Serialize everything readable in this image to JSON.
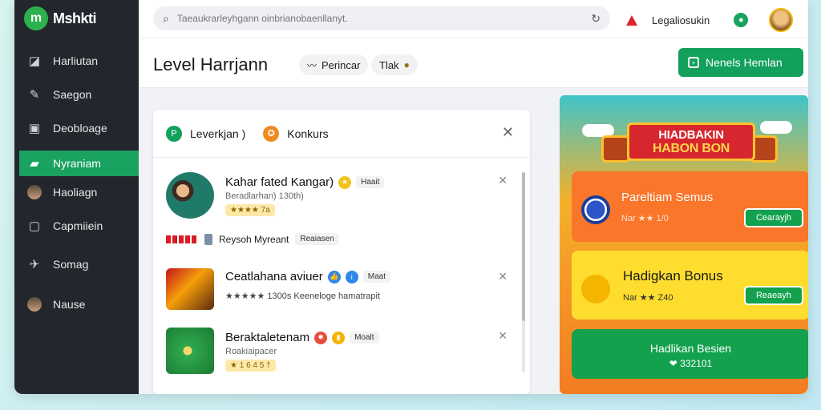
{
  "app": {
    "name": "Mshkti"
  },
  "sidebar": {
    "items": [
      {
        "label": "Harliutan",
        "icon": "dashboard-icon",
        "active": false
      },
      {
        "label": "Saegon",
        "icon": "pen-icon",
        "active": false
      },
      {
        "label": "Deobloage",
        "icon": "door-icon",
        "active": false
      },
      {
        "label": "Nyraniam",
        "icon": "folder-icon",
        "active": true
      },
      {
        "label": "Haoliagn",
        "icon": "user-avatar-icon",
        "active": false
      },
      {
        "label": "Capmiiein",
        "icon": "square-icon",
        "active": false
      },
      {
        "label": "Somag",
        "icon": "bird-icon",
        "active": false
      },
      {
        "label": "Nause",
        "icon": "user-avatar-icon",
        "active": false
      }
    ]
  },
  "topbar": {
    "search_placeholder": "Taeaukrarleyhgann oinbrianobaenllanyt.",
    "link": "Legaliosukin"
  },
  "header": {
    "title": "Level Harrjann",
    "chip1": "Perincar",
    "chip2": "Tlak",
    "cta": "Nenels Hemlan"
  },
  "panel": {
    "tab1": "Leverkjan )",
    "tab2": "Konkurs",
    "rows": [
      {
        "title": "Kahar fated Kangar)",
        "badge": "Haait",
        "sub": "Beradlarhan) 130th)",
        "rating": "★★★★ 7a"
      },
      {
        "title": "Ceatlahana aviuer",
        "badge": "Maat",
        "sub": "",
        "rating": "★★★★★ 1300s Keeneloge hamatrapit"
      },
      {
        "title": "Beraktaletenam",
        "badge": "Moalt",
        "sub": "Roakiaipacer",
        "rating": "★ 1 6 4 5 †"
      }
    ],
    "mini": {
      "text": "Reysoh Myreant",
      "badge": "Reaiasen"
    }
  },
  "promo": {
    "banner_line1": "HIADBAKIN",
    "banner_line2": "HABON BON",
    "cards": [
      {
        "title": "Pareltiam Semus",
        "sub": "Nar ★★ 1/0",
        "button": "Cearayjh"
      },
      {
        "title": "Hadigkan Bonus",
        "sub": "Nar ★★ Z40",
        "button": "Reaeayh"
      }
    ],
    "footer_title": "Hadlikan Besien",
    "footer_code": "❤ 332101"
  }
}
